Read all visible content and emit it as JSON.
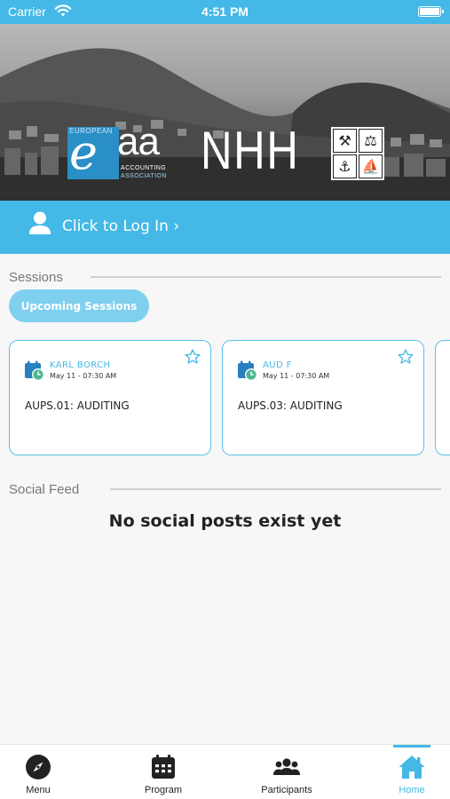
{
  "status_bar": {
    "carrier": "Carrier",
    "time": "4:51 PM"
  },
  "banner": {
    "eaa_european": "EUROPEAN",
    "eaa_e": "e",
    "eaa_aa": "aa",
    "eaa_accounting": "ACCOUNTING",
    "eaa_association": "ASSOCIATION",
    "nhh": "NHH"
  },
  "login": {
    "label": "Click to Log In ›"
  },
  "sessions": {
    "title": "Sessions",
    "filter_label": "Upcoming Sessions",
    "cards": [
      {
        "speaker": "KARL BORCH",
        "datetime": "May 11 - 07:30 AM",
        "title": "AUPS.01: AUDITING"
      },
      {
        "speaker": "AUD F",
        "datetime": "May 11 - 07:30 AM",
        "title": "AUPS.03: AUDITING"
      }
    ]
  },
  "social_feed": {
    "title": "Social Feed",
    "empty_message": "No social posts exist yet"
  },
  "tabbar": {
    "tabs": [
      {
        "label": "Menu",
        "icon": "compass-icon"
      },
      {
        "label": "Program",
        "icon": "calendar-icon"
      },
      {
        "label": "Participants",
        "icon": "people-icon"
      },
      {
        "label": "Home",
        "icon": "home-icon",
        "active": true
      }
    ]
  },
  "colors": {
    "accent": "#44b8e6",
    "pill": "#7fd0ef",
    "eaa_blue": "#2a8fc7"
  }
}
